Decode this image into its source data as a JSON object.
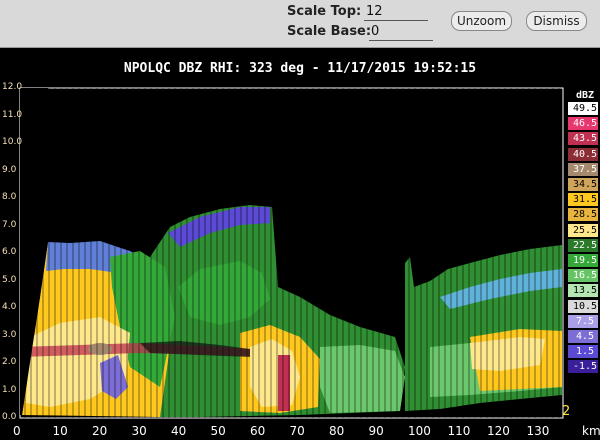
{
  "toolbar": {
    "scale_top_label": "Scale Top:",
    "scale_top_value": "12",
    "scale_base_label": "Scale Base:",
    "scale_base_value": "0",
    "unzoom_label": "Unzoom",
    "dismiss_label": "Dismiss"
  },
  "plot": {
    "title": "NPOLQC DBZ  RHI: 323 deg  -  11/17/2015 19:52:15",
    "x_unit": "km",
    "zoom_indicator": "2",
    "x_ticks": [
      "0",
      "10",
      "20",
      "30",
      "40",
      "50",
      "60",
      "70",
      "80",
      "90",
      "100",
      "110",
      "120",
      "130"
    ],
    "y_ticks": [
      "0.0",
      "1.0",
      "2.0",
      "3.0",
      "4.0",
      "5.0",
      "6.0",
      "7.0",
      "8.0",
      "9.0",
      "10.0",
      "11.0",
      "12.0"
    ]
  },
  "colorbar": {
    "title": "dBZ",
    "levels": [
      "49.5",
      "46.5",
      "43.5",
      "40.5",
      "37.5",
      "34.5",
      "31.5",
      "28.5",
      "25.5",
      "22.5",
      "19.5",
      "16.5",
      "13.5",
      "10.5",
      "7.5",
      "4.5",
      "1.5",
      "-1.5"
    ],
    "colors": [
      "#ffffff",
      "#e8366e",
      "#c03050",
      "#8c2c34",
      "#a5896e",
      "#cfa55c",
      "#ffc81e",
      "#e7b43e",
      "#ffe88c",
      "#2a7a2a",
      "#34a838",
      "#66c466",
      "#b4e6b4",
      "#dadada",
      "#aaa0e8",
      "#7c6ed4",
      "#5a4ad4",
      "#3a1e9a"
    ]
  },
  "colors": {
    "toolbar_bg": "#d9d9d9",
    "plot_bg": "#000000"
  }
}
